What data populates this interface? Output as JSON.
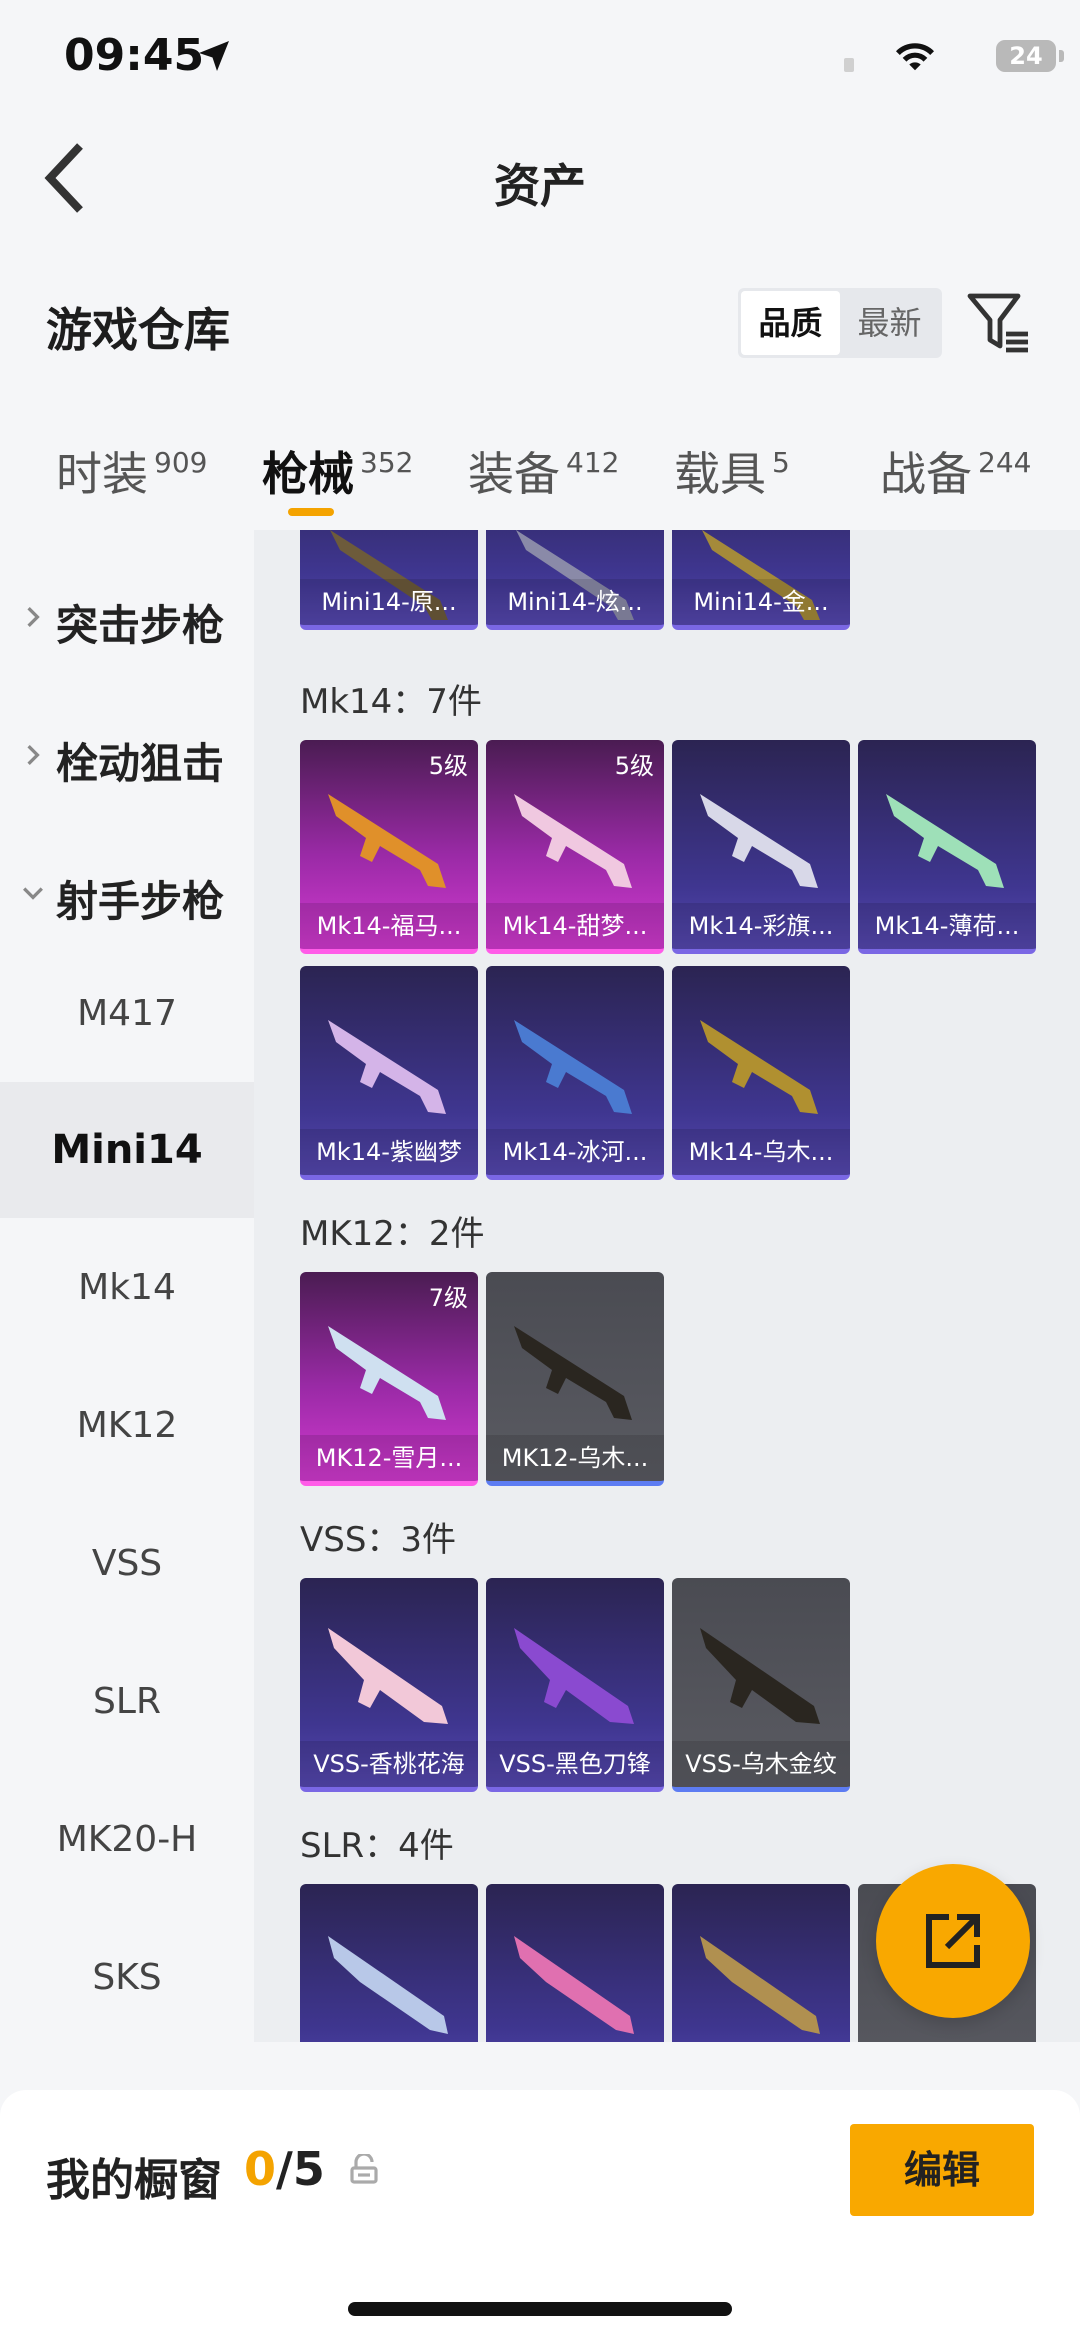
{
  "status_bar": {
    "time": "09:45",
    "battery": "24"
  },
  "header": {
    "title": "资产"
  },
  "warehouse": {
    "title": "游戏仓库",
    "sort_options": [
      "品质",
      "最新"
    ],
    "sort_selected": "品质"
  },
  "tabs": [
    {
      "label": "时装",
      "count": "909"
    },
    {
      "label": "枪械",
      "count": "352"
    },
    {
      "label": "装备",
      "count": "412"
    },
    {
      "label": "载具",
      "count": "5"
    },
    {
      "label": "战备",
      "count": "244"
    }
  ],
  "sidebar": {
    "groups": [
      "突击步枪",
      "栓动狙击",
      "射手步枪"
    ],
    "items": [
      "M417",
      "Mini14",
      "Mk14",
      "MK12",
      "VSS",
      "SLR",
      "MK20-H",
      "SKS"
    ],
    "active": "Mini14"
  },
  "groups": {
    "mini14": {
      "items": [
        "Mini14-原...",
        "Mini14-炫...",
        "Mini14-金..."
      ]
    },
    "mk14": {
      "header": "Mk14：7件",
      "items": [
        {
          "name": "Mk14-福马...",
          "level": "5级"
        },
        {
          "name": "Mk14-甜梦...",
          "level": "5级"
        },
        {
          "name": "Mk14-彩旗..."
        },
        {
          "name": "Mk14-薄荷..."
        },
        {
          "name": "Mk14-紫幽梦"
        },
        {
          "name": "Mk14-冰河..."
        },
        {
          "name": "Mk14-乌木..."
        }
      ]
    },
    "mk12": {
      "header": "MK12：2件",
      "items": [
        {
          "name": "MK12-雪月...",
          "level": "7级"
        },
        {
          "name": "MK12-乌木..."
        }
      ]
    },
    "vss": {
      "header": "VSS：3件",
      "items": [
        {
          "name": "VSS-香桃花海"
        },
        {
          "name": "VSS-黑色刀锋"
        },
        {
          "name": "VSS-乌木金纹"
        }
      ]
    },
    "slr": {
      "header": "SLR：4件"
    }
  },
  "bottom": {
    "showcase_label": "我的橱窗",
    "showcase_current": "0",
    "showcase_total": "/5",
    "edit_label": "编辑"
  },
  "colors": {
    "accent": "#f9a800",
    "blue_card": "#3f3690",
    "pink_card": "#b030b8",
    "gray_card": "#55565d"
  }
}
